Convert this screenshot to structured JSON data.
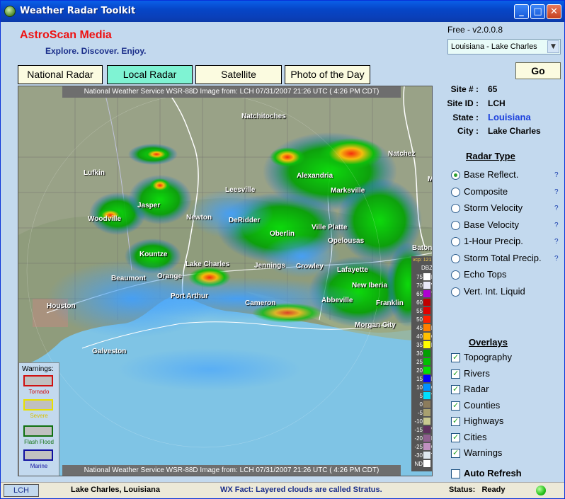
{
  "window": {
    "title": "Weather Radar Toolkit"
  },
  "brand": {
    "name": "AstroScan Media",
    "tagline": "Explore.  Discover.  Enjoy."
  },
  "version": "Free - v2.0.0.8",
  "site_select": {
    "selected": "Louisiana - Lake Charles"
  },
  "go_label": "Go",
  "tabs": [
    {
      "label": "National Radar",
      "active": false
    },
    {
      "label": "Local Radar",
      "active": true
    },
    {
      "label": "Satellite",
      "active": false
    },
    {
      "label": "Photo of the Day",
      "active": false
    }
  ],
  "map": {
    "header": "National Weather Service WSR-88D Image from:  LCH  07/31/2007  21:26 UTC  ( 4:26 PM CDT)",
    "footer": "National Weather Service WSR-88D Image from:  LCH  07/31/2007  21:26 UTC  ( 4:26 PM CDT)",
    "cities": [
      "Natchitoches",
      "Natchez",
      "Lufkin",
      "Alexandria",
      "Leesville",
      "Marksville",
      "Jasper",
      "Newton",
      "DeRidder",
      "Woodville",
      "Oberlin",
      "Ville Platte",
      "Opelousas",
      "Lafayette",
      "Kountze",
      "Lake Charles",
      "Jennings",
      "Crowley",
      "Beaumont",
      "Orange",
      "New Iberia",
      "Port Arthur",
      "Abbeville",
      "Houston",
      "Cameron",
      "Franklin",
      "Morgan City",
      "Galveston",
      "Baton Rouge",
      "Mc"
    ],
    "vcp": "vcp: 121",
    "unit": "DBZ"
  },
  "legend": [
    {
      "v": "75",
      "c": "#ffffff",
      "l": "H"
    },
    {
      "v": "70",
      "c": "#e8e8f8",
      "l": "V"
    },
    {
      "v": "65",
      "c": "#b000d0",
      "l": "Y"
    },
    {
      "v": "60",
      "c": "#c00000",
      "l": ""
    },
    {
      "v": "55",
      "c": "#e00000",
      "l": ""
    },
    {
      "v": "50",
      "c": "#ff2000",
      "l": ""
    },
    {
      "v": "45",
      "c": "#ff8000",
      "l": "M"
    },
    {
      "v": "40",
      "c": "#ffc000",
      "l": "O"
    },
    {
      "v": "35",
      "c": "#ffff00",
      "l": "D"
    },
    {
      "v": "30",
      "c": "#00a000",
      "l": ""
    },
    {
      "v": "25",
      "c": "#00c000",
      "l": ""
    },
    {
      "v": "20",
      "c": "#00e000",
      "l": ""
    },
    {
      "v": "15",
      "c": "#0000ff",
      "l": "L"
    },
    {
      "v": "10",
      "c": "#0090ff",
      "l": "G"
    },
    {
      "v": "5",
      "c": "#00e0ff",
      "l": "T"
    },
    {
      "v": "0",
      "c": "#8c7c5c",
      "l": ""
    },
    {
      "v": "-5",
      "c": "#a8a070",
      "l": ""
    },
    {
      "v": "-10",
      "c": "#c8c890",
      "l": ""
    },
    {
      "v": "-15",
      "c": "#603060",
      "l": "V"
    },
    {
      "v": "-20",
      "c": "#906090",
      "l": "L"
    },
    {
      "v": "-25",
      "c": "#c090c0",
      "l": "G"
    },
    {
      "v": "-30",
      "c": "#e0e8f0",
      "l": "T"
    },
    {
      "v": "ND",
      "c": "#ffffff",
      "l": ""
    }
  ],
  "warnings": {
    "title": "Warnings:",
    "items": [
      {
        "label": "Tornado",
        "color": "#d01010"
      },
      {
        "label": "Severe",
        "color": "#e8e000"
      },
      {
        "label": "Flash Flood",
        "color": "#107010"
      },
      {
        "label": "Marine",
        "color": "#1010a0"
      }
    ]
  },
  "site": {
    "site_num_label": "Site # :",
    "site_num": "65",
    "site_id_label": "Site ID :",
    "site_id": "LCH",
    "state_label": "State :",
    "state": "Louisiana",
    "city_label": "City :",
    "city": "Lake Charles"
  },
  "radar_type": {
    "heading": "Radar Type",
    "options": [
      {
        "label": "Base Reflect.",
        "checked": true,
        "help": true
      },
      {
        "label": "Composite",
        "checked": false,
        "help": true
      },
      {
        "label": "Storm Velocity",
        "checked": false,
        "help": true
      },
      {
        "label": "Base Velocity",
        "checked": false,
        "help": true
      },
      {
        "label": "1-Hour Precip.",
        "checked": false,
        "help": true
      },
      {
        "label": "Storm Total Precip.",
        "checked": false,
        "help": true
      },
      {
        "label": "Echo Tops",
        "checked": false,
        "help": false
      },
      {
        "label": "Vert. Int. Liquid",
        "checked": false,
        "help": false
      }
    ],
    "help_glyph": "?"
  },
  "overlays": {
    "heading": "Overlays",
    "items": [
      {
        "label": "Topography",
        "checked": true
      },
      {
        "label": "Rivers",
        "checked": true
      },
      {
        "label": "Radar",
        "checked": true
      },
      {
        "label": "Counties",
        "checked": true
      },
      {
        "label": "Highways",
        "checked": true
      },
      {
        "label": "Cities",
        "checked": true
      },
      {
        "label": "Warnings",
        "checked": true
      }
    ],
    "auto_refresh": {
      "label": "Auto Refresh",
      "checked": false
    }
  },
  "status": {
    "code": "LCH",
    "location": "Lake Charles, Louisiana",
    "fact": "WX Fact: Layered clouds are called Stratus.",
    "status_label": "Status:",
    "status_value": "Ready"
  },
  "colors": {
    "accent": "#7ff3d3",
    "brand": "#e11111",
    "titlebar": "#0646c8",
    "panel": "#c3d9ee"
  }
}
